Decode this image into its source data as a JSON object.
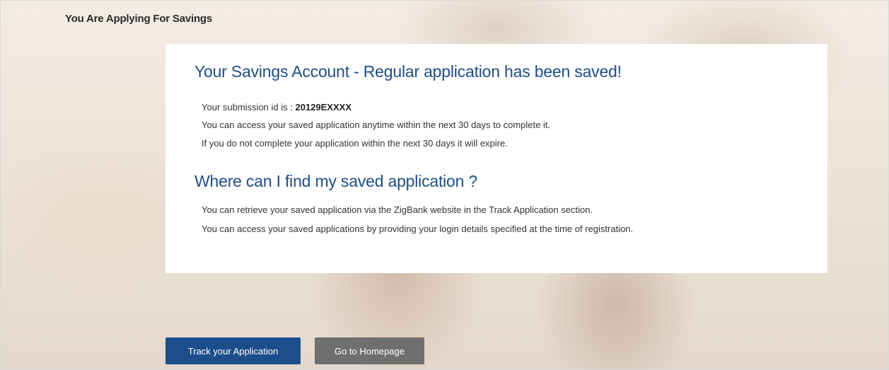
{
  "page": {
    "heading": "You Are Applying For Savings"
  },
  "confirmation": {
    "title": "Your Savings Account - Regular application has been saved!",
    "submission_prefix": "Your submission id is : ",
    "submission_id": "20129EXXXX",
    "access_note": "You can access your saved application anytime within the next 30 days to complete it.",
    "expiry_note": "If you do not complete your application within the next 30 days it will expire."
  },
  "find_section": {
    "title": "Where can I find my saved application ?",
    "retrieve_note": "You can retrieve your saved application via the ZigBank website in the Track Application section.",
    "login_note": "You can access your saved applications by providing your login details specified at the time of registration."
  },
  "actions": {
    "track_label": "Track your Application",
    "home_label": "Go to Homepage"
  },
  "colors": {
    "heading_blue": "#1f4e87",
    "primary_button": "#1d4e8c",
    "secondary_button": "#6f6f6f"
  }
}
